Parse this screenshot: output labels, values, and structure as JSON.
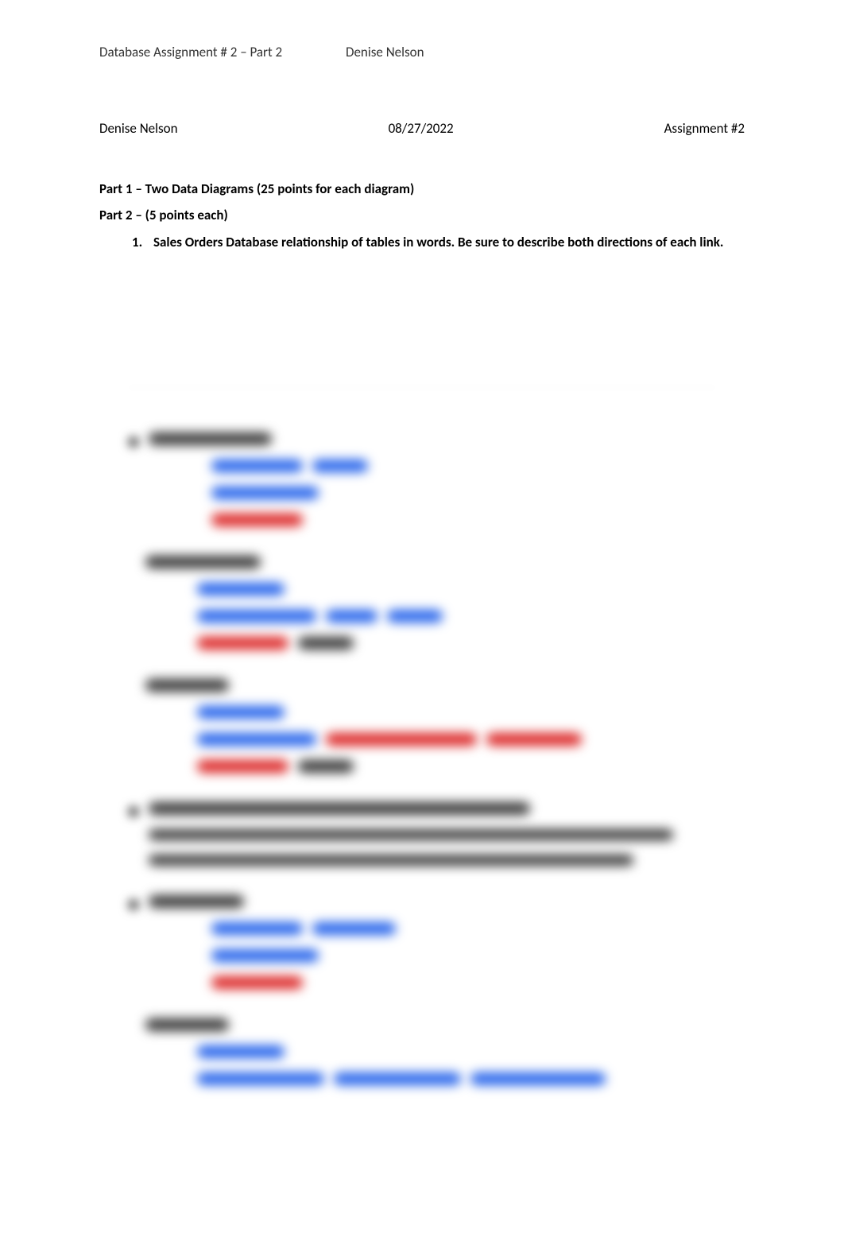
{
  "header": {
    "title": "Database Assignment # 2 – Part 2",
    "author": "Denise Nelson"
  },
  "meta": {
    "name": "Denise Nelson",
    "date": "08/27/2022",
    "assignment": "Assignment #2"
  },
  "parts": {
    "part1": "Part 1 – Two Data Diagrams (25 points for each diagram)",
    "part2": "Part 2 – (5 points each)"
  },
  "questions": {
    "q1": "Sales Orders Database relationship of tables in words. Be sure to describe both directions of each link."
  }
}
